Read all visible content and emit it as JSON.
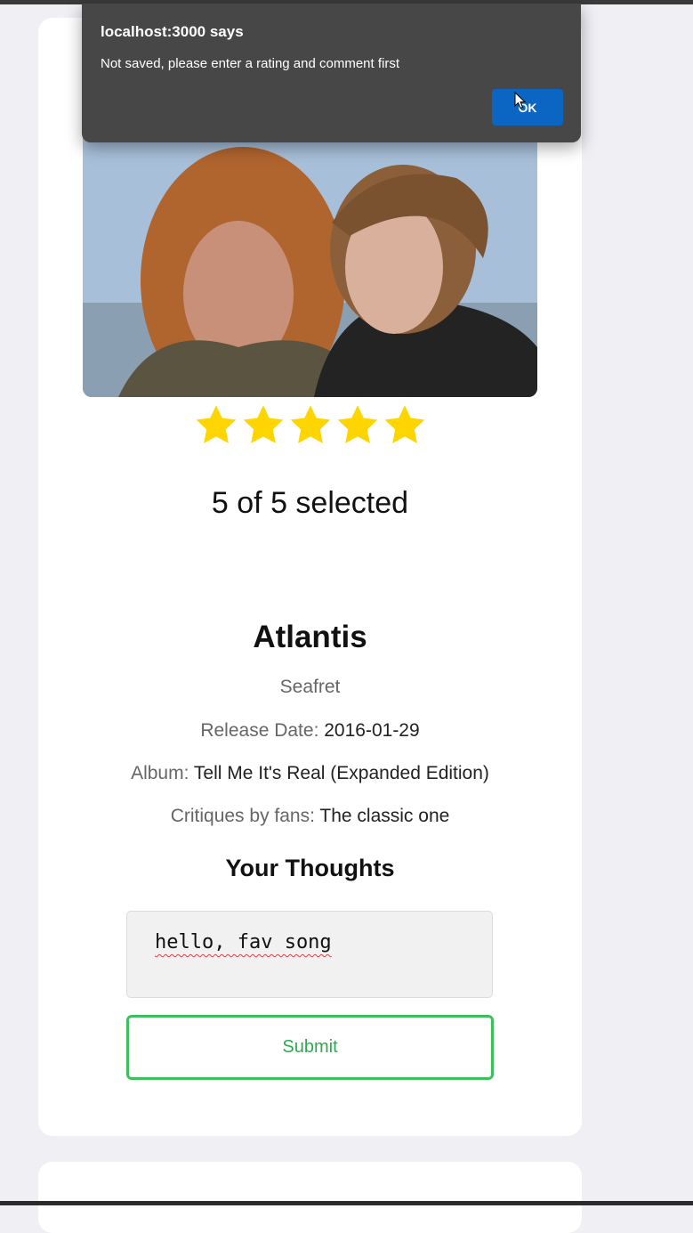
{
  "dialog": {
    "title": "localhost:3000 says",
    "message": "Not saved, please enter a rating and comment first",
    "ok_label": "OK"
  },
  "rating": {
    "value": 5,
    "max": 5,
    "star_color": "#ffd500",
    "selected_text": "5 of 5 selected"
  },
  "song": {
    "title": "Atlantis",
    "artist": "Seafret",
    "release_label": "Release Date:",
    "release_date": "2016-01-29",
    "album_label": "Album:",
    "album": "Tell Me It's Real (Expanded Edition)",
    "critiques_label": "Critiques by fans:",
    "critiques": "The classic one"
  },
  "thoughts": {
    "heading": "Your Thoughts",
    "comment_value": "hello, fav song",
    "submit_label": "Submit"
  },
  "colors": {
    "accent_green": "#3cbf5c",
    "dialog_button": "#0a66c2",
    "page_bg": "#efeff4"
  }
}
